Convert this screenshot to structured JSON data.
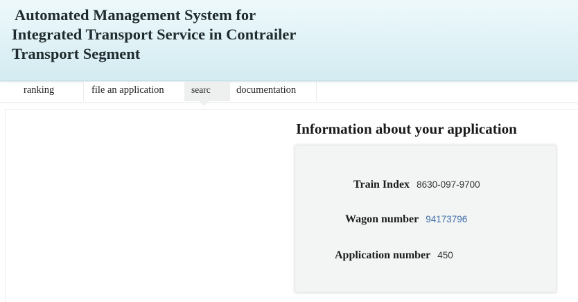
{
  "header": {
    "title_lines": [
      "Automated Management System for",
      "Integrated Transport Service in Contrailer",
      "Transport Segment"
    ]
  },
  "nav": {
    "tabs": [
      {
        "label": "ranking"
      },
      {
        "label": "file an application"
      },
      {
        "label": "searc",
        "active": true
      },
      {
        "label": "documentation"
      }
    ]
  },
  "main": {
    "section_title": "Information about your application",
    "fields": {
      "train_index": {
        "label": "Train Index",
        "value": "8630-097-9700"
      },
      "wagon_number": {
        "label": "Wagon number",
        "value": "94173796"
      },
      "application_number": {
        "label": "Application number",
        "value": "450"
      }
    }
  },
  "colors": {
    "header_bg": "#e2f3f7",
    "active_tab_bg": "#eef0f0",
    "panel_bg": "#f3f4f4",
    "link_value": "#3f6fa8"
  }
}
